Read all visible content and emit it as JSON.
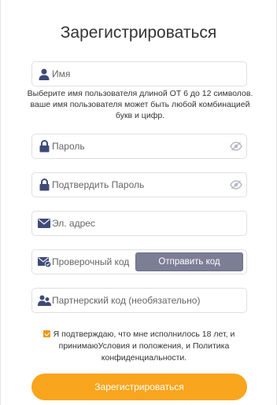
{
  "title": "Зарегистрироваться",
  "username": {
    "placeholder": "Имя",
    "hint": "Выберите имя пользователя длиной ОТ 6 до 12 символов. ваше имя пользователя может быть любой комбинацией букв и цифр."
  },
  "password": {
    "placeholder": "Пароль"
  },
  "confirm_password": {
    "placeholder": "Подтвердить Пароль"
  },
  "email": {
    "placeholder": "Эл. адрес"
  },
  "verification": {
    "placeholder": "Проверочный код",
    "send_label": "Отправить код"
  },
  "partner": {
    "placeholder": "Партнерский код (необязательно)"
  },
  "agreement": {
    "checked": true,
    "text": "Я подтверждаю, что мне исполнилось 18 лет, и принимаюУсловия и положения, и  Политика конфиденциальности."
  },
  "submit_label": "Зарегистрироваться",
  "colors": {
    "accent": "#f9a51d",
    "icon": "#3e4a78",
    "send_button": "#7c7e96"
  },
  "icons": [
    "user-icon",
    "lock-icon",
    "eye-slash-icon",
    "mail-icon",
    "mail-check-icon",
    "users-icon"
  ]
}
